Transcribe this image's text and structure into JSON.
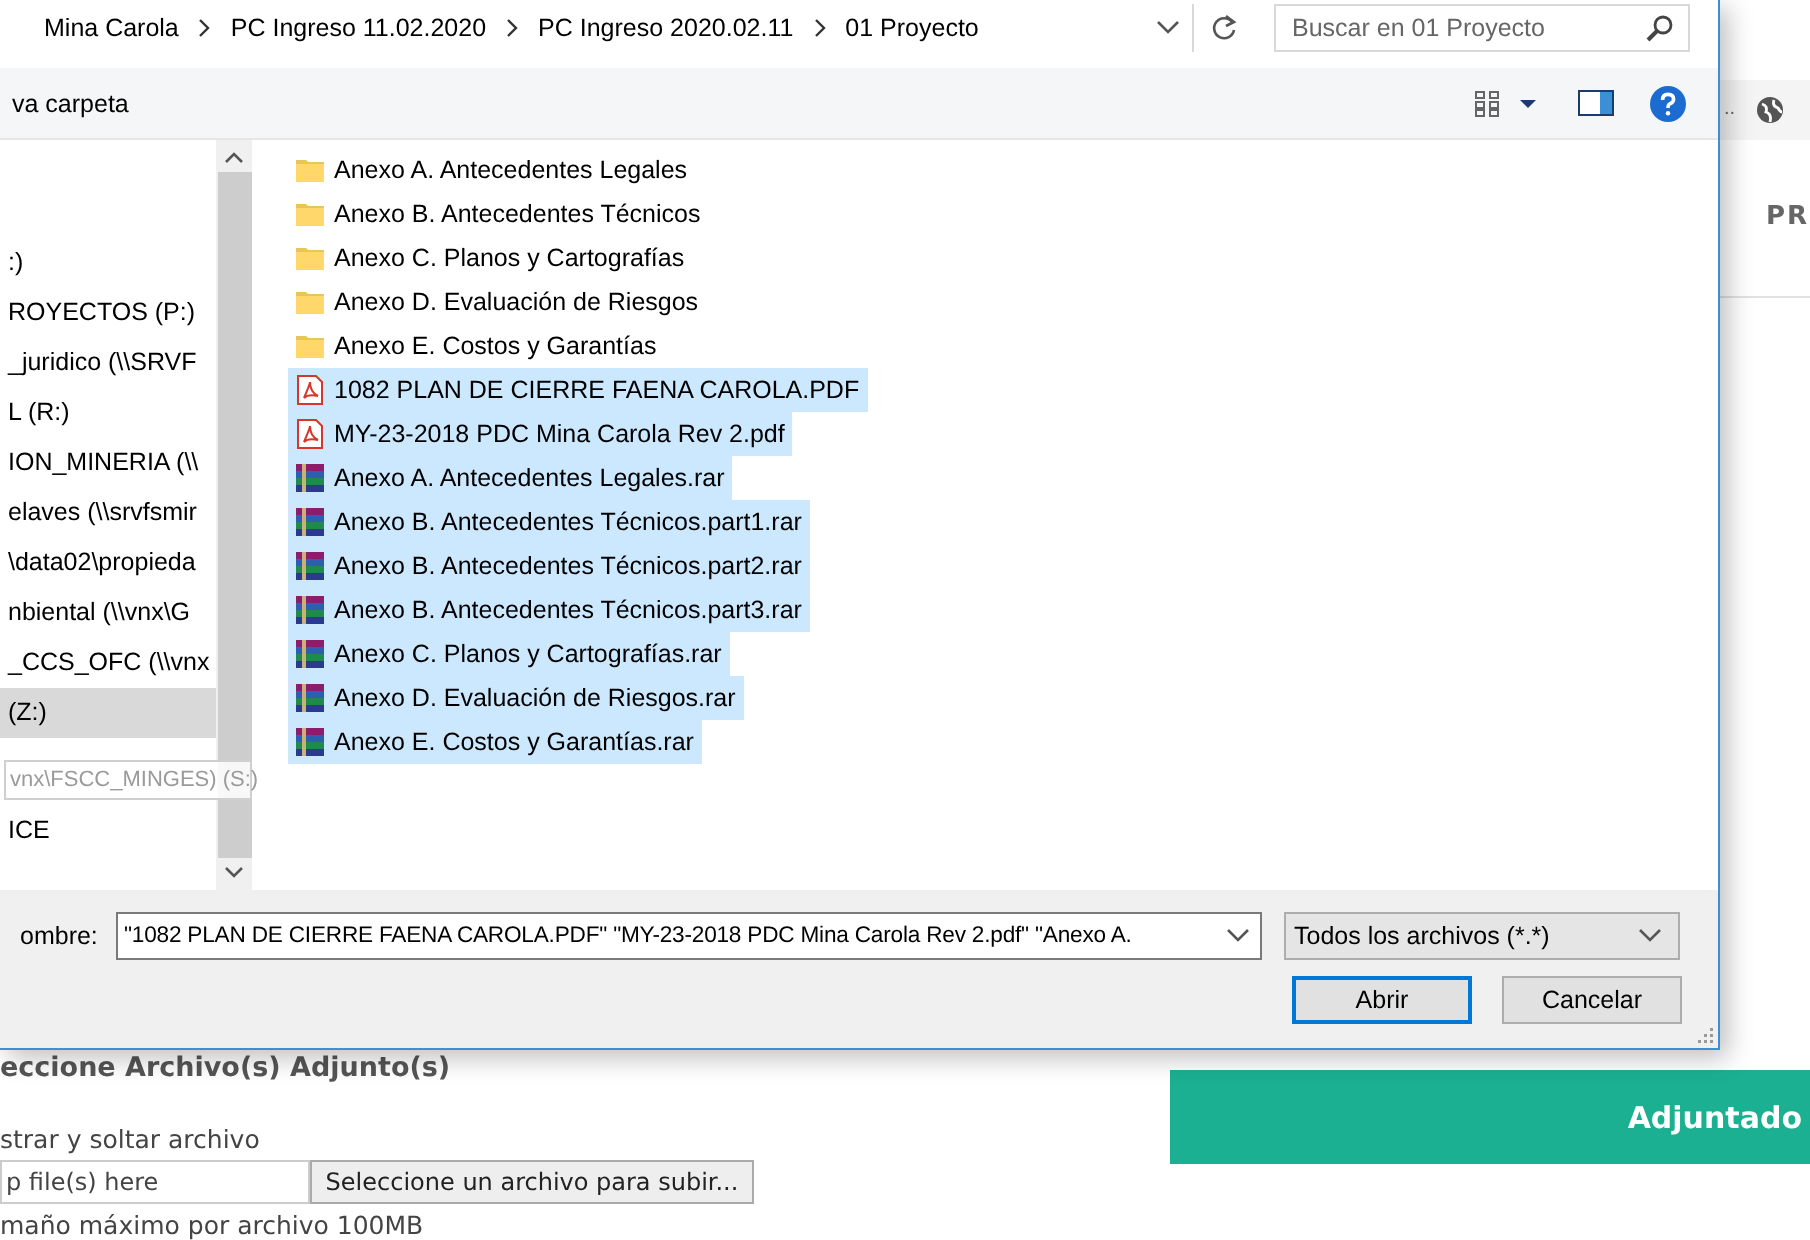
{
  "breadcrumb": [
    "Mina Carola",
    "PC Ingreso 11.02.2020",
    "PC Ingreso 2020.02.11",
    "01 Proyecto"
  ],
  "search": {
    "placeholder": "Buscar en 01 Proyecto"
  },
  "toolbar": {
    "new_folder": "va carpeta"
  },
  "nav_items": [
    {
      "label": ":)",
      "selected": false
    },
    {
      "label": "ROYECTOS (P:)",
      "selected": false
    },
    {
      "label": "_juridico (\\\\SRVF",
      "selected": false
    },
    {
      "label": "L (R:)",
      "selected": false
    },
    {
      "label": "ION_MINERIA (\\\\",
      "selected": false
    },
    {
      "label": "elaves (\\\\srvfsmir",
      "selected": false
    },
    {
      "label": "\\data02\\propieda",
      "selected": false
    },
    {
      "label": "nbiental (\\\\vnx\\G",
      "selected": false
    },
    {
      "label": "_CCS_OFC (\\\\vnx",
      "selected": false
    },
    {
      "label": "(Z:)",
      "selected": true
    },
    {
      "label": "ICE",
      "selected": false
    }
  ],
  "drag_ghost": "vnx\\FSCC_MINGES) (S:)",
  "files": [
    {
      "name": "Anexo A. Antecedentes Legales",
      "kind": "folder",
      "selected": false
    },
    {
      "name": "Anexo B. Antecedentes Técnicos",
      "kind": "folder",
      "selected": false
    },
    {
      "name": "Anexo C. Planos y Cartografías",
      "kind": "folder",
      "selected": false
    },
    {
      "name": "Anexo D. Evaluación de Riesgos",
      "kind": "folder",
      "selected": false
    },
    {
      "name": "Anexo E. Costos y Garantías",
      "kind": "folder",
      "selected": false
    },
    {
      "name": "1082 PLAN DE CIERRE FAENA CAROLA.PDF",
      "kind": "pdf",
      "selected": true
    },
    {
      "name": "MY-23-2018 PDC Mina Carola Rev 2.pdf",
      "kind": "pdf",
      "selected": true
    },
    {
      "name": "Anexo A. Antecedentes Legales.rar",
      "kind": "rar",
      "selected": true
    },
    {
      "name": "Anexo B. Antecedentes Técnicos.part1.rar",
      "kind": "rar",
      "selected": true
    },
    {
      "name": "Anexo B. Antecedentes Técnicos.part2.rar",
      "kind": "rar",
      "selected": true
    },
    {
      "name": "Anexo B. Antecedentes Técnicos.part3.rar",
      "kind": "rar",
      "selected": true
    },
    {
      "name": "Anexo C. Planos y Cartografías.rar",
      "kind": "rar",
      "selected": true
    },
    {
      "name": "Anexo D. Evaluación de Riesgos.rar",
      "kind": "rar",
      "selected": true
    },
    {
      "name": "Anexo E. Costos y Garantías.rar",
      "kind": "rar",
      "selected": true
    }
  ],
  "filename": {
    "label": "ombre:",
    "value": "\"1082 PLAN DE CIERRE FAENA CAROLA.PDF\" \"MY-23-2018 PDC Mina Carola Rev 2.pdf\" \"Anexo A."
  },
  "filetype": "Todos los archivos (*.*)",
  "buttons": [
    {
      "label": "Abrir",
      "default": true
    },
    {
      "label": "Cancelar",
      "default": false
    }
  ],
  "page": {
    "more": "..",
    "tab_text": "PR",
    "heading": "eccione Archivo(s) Adjunto(s)",
    "drop_label": "strar y soltar archivo",
    "drop_placeholder": "p file(s) here",
    "choose_button": "Seleccione un archivo para subir...",
    "size_note": "maño máximo por archivo 100MB",
    "attach_button": "Adjuntado"
  }
}
